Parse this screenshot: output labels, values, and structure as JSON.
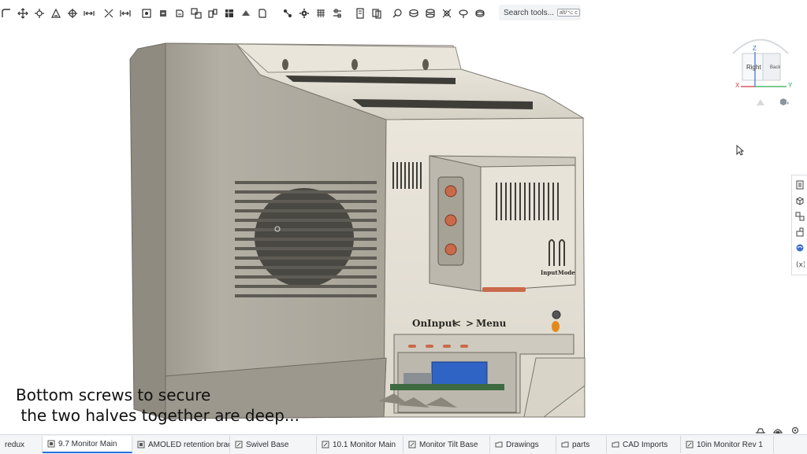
{
  "toolbar": {
    "search_placeholder": "Search tools...",
    "search_shortcut": "alt/⌥ c",
    "tools_group1": [
      "fillet-icon",
      "move-icon",
      "transform-icon",
      "shell-icon",
      "pattern-icon",
      "mirror-icon",
      "boolean-icon",
      "split-icon"
    ],
    "tools_group2": [
      "plane-icon",
      "helix-icon",
      "mate-connector-icon",
      "sweep-icon",
      "loft-icon",
      "table-icon",
      "variable-icon",
      "derived-icon"
    ],
    "tools_group3": [
      "section-icon",
      "gear-icon",
      "appearance-icon",
      "list-icon",
      "measure-icon",
      "copy-icon",
      "hole-icon",
      "thread-icon",
      "rib-icon",
      "rotate-icon",
      "ring-icon",
      "wrap-icon"
    ]
  },
  "view_cube": {
    "face_front": "Right",
    "face_side": "Back",
    "axis_x": "X",
    "axis_y": "Y",
    "axis_z": "Z"
  },
  "model_labels": {
    "on": "On",
    "input": "Input",
    "left": "<",
    "right": ">",
    "menu": "Menu",
    "port_input": "Input",
    "port_mode": "Mode"
  },
  "caption": {
    "line1": "Bottom screws to secure",
    "line2": " the two halves together are deep..."
  },
  "tabs": [
    {
      "label": "redux",
      "icon": "part-studio-icon",
      "active": false
    },
    {
      "label": "9.7 Monitor Main",
      "icon": "part-studio-icon",
      "active": true
    },
    {
      "label": "AMOLED retention brac...",
      "icon": "part-studio-icon",
      "active": false
    },
    {
      "label": "Swivel Base",
      "icon": "assembly-icon",
      "active": false
    },
    {
      "label": "10.1 Monitor Main",
      "icon": "assembly-icon",
      "active": false
    },
    {
      "label": "Monitor Tilt Base",
      "icon": "assembly-icon",
      "active": false
    },
    {
      "label": "Drawings",
      "icon": "folder-icon",
      "active": false
    },
    {
      "label": "parts",
      "icon": "folder-icon",
      "active": false
    },
    {
      "label": "CAD Imports",
      "icon": "folder-icon",
      "active": false
    },
    {
      "label": "10in Monitor Rev 1",
      "icon": "assembly-icon",
      "active": false
    }
  ],
  "colors": {
    "body": "#e6e1d6",
    "body_shadow": "#a8a498",
    "port_orange": "#c96a4b",
    "tab_active": "#2a6fd6"
  }
}
